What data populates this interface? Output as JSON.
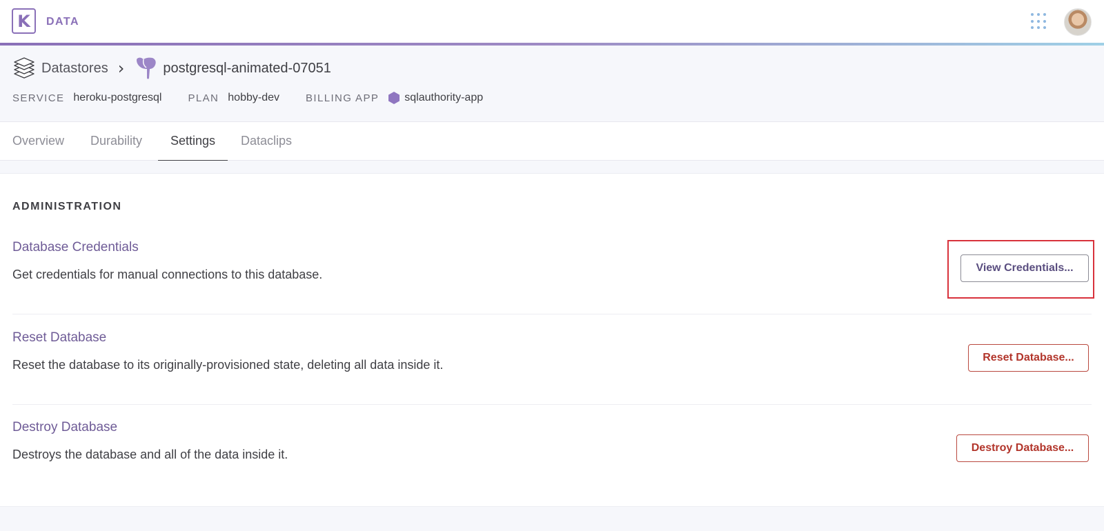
{
  "app": {
    "logo_letter": "K",
    "name": "DATA"
  },
  "breadcrumb": {
    "root": "Datastores",
    "separator": "›",
    "current": "postgresql-animated-07051"
  },
  "meta": [
    {
      "key": "SERVICE",
      "value": "heroku-postgresql"
    },
    {
      "key": "PLAN",
      "value": "hobby-dev"
    },
    {
      "key": "BILLING APP",
      "value": "sqlauthority-app"
    }
  ],
  "tabs": [
    {
      "label": "Overview",
      "active": false
    },
    {
      "label": "Durability",
      "active": false
    },
    {
      "label": "Settings",
      "active": true
    },
    {
      "label": "Dataclips",
      "active": false
    }
  ],
  "administration": {
    "heading": "ADMINISTRATION",
    "rows": [
      {
        "title": "Database Credentials",
        "description": "Get credentials for manual connections to this database.",
        "button": "View Credentials...",
        "variant": "primary"
      },
      {
        "title": "Reset Database",
        "description": "Reset the database to its originally-provisioned state, deleting all data inside it.",
        "button": "Reset Database...",
        "variant": "danger"
      },
      {
        "title": "Destroy Database",
        "description": "Destroys the database and all of the data inside it.",
        "button": "Destroy Database...",
        "variant": "danger"
      }
    ]
  },
  "colors": {
    "brand": "#8a70b8",
    "danger": "#b2352b",
    "highlight": "#d8313b"
  },
  "icons": {
    "logo": "heroku-logo-icon",
    "apps": "apps-grid-icon",
    "datastores": "datastores-stack-icon",
    "postgres": "postgres-elephant-icon",
    "billing_app": "hexagon-app-icon"
  }
}
